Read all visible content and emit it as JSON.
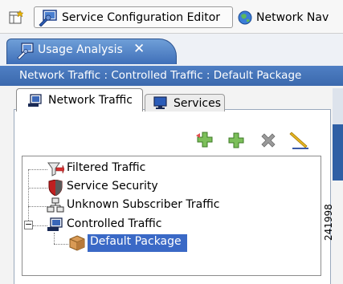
{
  "toolbar": {
    "perspective1_label": "Service Configuration Editor",
    "perspective2_label": "Network Nav",
    "perspective2_icon": "globe-icon",
    "perspective1_icon": "config-editor-icon",
    "open_perspective_icon": "open-perspective-icon"
  },
  "editor_tab": {
    "label": "Usage Analysis",
    "close_glyph": "✕",
    "icon": "usage-analysis-icon"
  },
  "breadcrumb": {
    "text": "Network Traffic : Controlled Traffic : Default Package"
  },
  "subtabs": [
    {
      "label": "Network Traffic",
      "icon": "network-traffic-icon",
      "selected": true
    },
    {
      "label": "Services",
      "icon": "monitor-icon",
      "selected": false
    }
  ],
  "actions": [
    {
      "icon": "add-child-icon"
    },
    {
      "icon": "add-icon"
    },
    {
      "icon": "delete-icon"
    },
    {
      "icon": "edit-icon"
    }
  ],
  "tree": {
    "nodes": [
      {
        "label": "Filtered Traffic",
        "icon": "filter-icon"
      },
      {
        "label": "Service Security",
        "icon": "shield-icon"
      },
      {
        "label": "Unknown Subscriber Traffic",
        "icon": "subscriber-network-icon"
      },
      {
        "label": "Controlled Traffic",
        "icon": "controlled-traffic-icon",
        "expanded": true,
        "expander": "−"
      },
      {
        "label": "Default Package",
        "icon": "package-icon",
        "selected": true
      }
    ]
  },
  "watermark": {
    "text": "241998"
  },
  "colors": {
    "tab_active": "#3f6fb8",
    "breadcrumb_bg": "#3b69ad",
    "selection": "#3a69c6"
  }
}
